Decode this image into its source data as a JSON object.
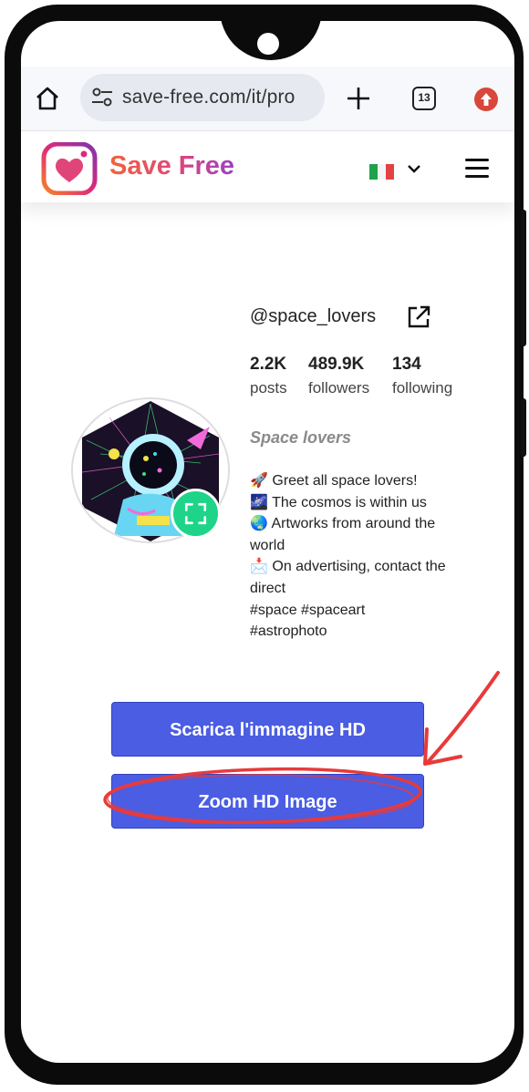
{
  "browser": {
    "url": "save-free.com/it/pro",
    "tab_count": "13"
  },
  "site": {
    "name": "Save Free",
    "language_flag": "IT"
  },
  "profile": {
    "username": "@space_lovers",
    "stats": [
      {
        "value": "2.2K",
        "label": "posts"
      },
      {
        "value": "489.9K",
        "label": "followers"
      },
      {
        "value": "134",
        "label": "following"
      }
    ],
    "full_name": "Space lovers",
    "bio_lines": [
      "🚀 Greet all space lovers!",
      "🌌 The cosmos is within us",
      "🌏 Artworks from around the world",
      "📩 On advertising, contact the direct",
      "#space #spaceart",
      "#astrophoto"
    ]
  },
  "buttons": {
    "download_hd": "Scarica l'immagine HD",
    "zoom_hd": "Zoom HD Image"
  },
  "colors": {
    "primary_button": "#4a5de3",
    "annotation_red": "#e83a3a",
    "zoom_badge": "#1ed489"
  }
}
